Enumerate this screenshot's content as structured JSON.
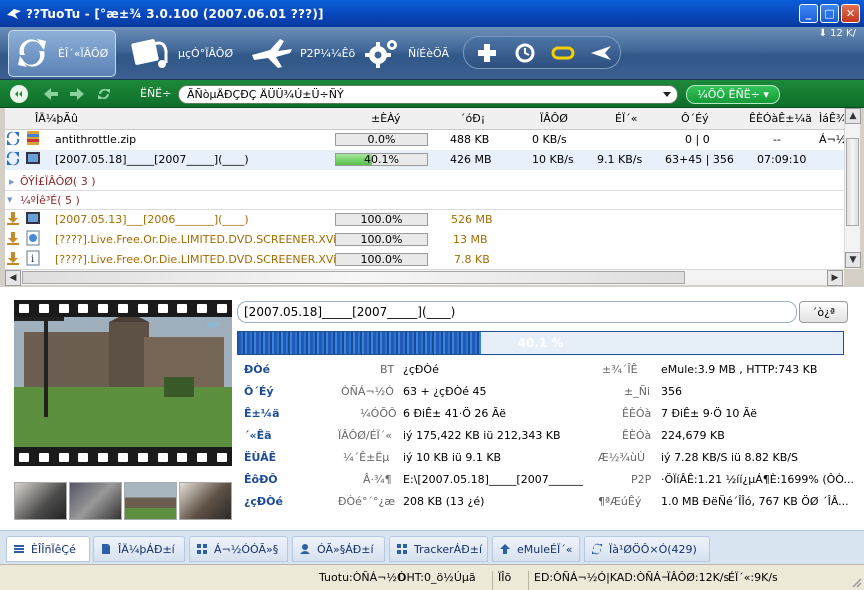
{
  "window": {
    "title": "??TuoTu - [°æ±¾ 3.0.100 (2007.06.01 ???)]",
    "buttons": [
      "_",
      "□",
      "✕"
    ]
  },
  "toolbar": {
    "items": [
      {
        "label": "ÈÎ´«ÏÂÔØ",
        "icon": "arrows-icon"
      },
      {
        "label": "µçÓ°ÏÂÔØ",
        "icon": "movie-icon"
      },
      {
        "label": "P2P¼¼Êõ",
        "icon": "plane-icon"
      },
      {
        "label": "ÑíÉèÖÃ",
        "icon": "gear-icon"
      }
    ],
    "small_icons": [
      "plus-icon",
      "clock-icon",
      "ring-icon",
      "share-icon"
    ],
    "speed": "12 K/"
  },
  "searchbar": {
    "label": "ËÑË÷",
    "input_value": "ÃÑòµÄÐÇÐÇ ÄÜÜ¾Ú±Ü÷ÑÝ",
    "go_label": "¼ÕÔ ËÑË÷"
  },
  "columns": [
    "ÎÄ¼þÃû",
    "±ÈÀý",
    "´óÐ¡",
    "ÏÂÔØ",
    "ÉÏ´«",
    "Ô´Éý",
    "ÊÈÓàÊ±¼ä",
    "ÌáÊ¾"
  ],
  "tasks": [
    {
      "name": "antithrottle.zip",
      "progress": 0.0,
      "progress_text": "0.0%",
      "size": "488 KB",
      "down": "0 KB/s",
      "up": "",
      "sources": "0 | 0",
      "remaining": "--",
      "extra": "Á¬½Ó"
    },
    {
      "name": "[2007.05.18]_____[2007_____](____)",
      "progress": 40.1,
      "progress_text": "40.1%",
      "size": "426 MB",
      "down": "10 KB/s",
      "up": "9.1 KB/s",
      "sources": "63+45 | 356",
      "remaining": "07:09:10",
      "extra": ""
    }
  ],
  "groups": [
    {
      "label": "ÔÝÍ£ÏÂÔØ( 3 )",
      "expanded": false
    },
    {
      "label": "¼ºÍê³É( 5 )",
      "expanded": true
    }
  ],
  "completed": [
    {
      "name": "[2007.05.13]___[2006_______](____)",
      "progress_text": "100.0%",
      "size": "526 MB"
    },
    {
      "name": "[????].Live.Free.Or.Die.LIMITED.DVD.SCREENER.XVi...",
      "progress_text": "100.0%",
      "size": "13 MB"
    },
    {
      "name": "[????].Live.Free.Or.Die.LIMITED.DVD.SCREENER.XVi...",
      "progress_text": "100.0%",
      "size": "7.8 KB"
    }
  ],
  "detail": {
    "title": "[2007.05.18]_____[2007_____](____)",
    "button": "´ò¿ª",
    "progress": 40.1,
    "progress_text": "40.1 %",
    "rows": [
      {
        "k": "Ð­Òé",
        "g": "BT",
        "v": "¿çÐ­Òé",
        "k2": "±¾´ÎÊ",
        "v2": "eMule:3.9 MB , HTTP:743 KB"
      },
      {
        "k": "Ô´Éý",
        "g": "ÒÑÁ¬½Ó",
        "v": "63 + ¿çÐ­Òé 45",
        "k2": "±_Ñi",
        "v2": "356"
      },
      {
        "k": "Ê±¼ä",
        "g": "¼ÓÕÔ",
        "v": "6 ÐiÊ± 41·Ö 26 Ãë",
        "k2": "ÊÈÓà",
        "v2": "7 ÐiÊ± 9·Ö 10 Ãë"
      },
      {
        "k": "´«Êä",
        "g": "ÏÂÔØ/ÉÏ´«",
        "v": "iý 175,422 KB iü 212,343 KB",
        "k2": "ÊÈÓà",
        "v2": "224,679 KB"
      },
      {
        "k": "ËÙÂÊ",
        "g": "¼´Ê±Ëµ",
        "v": "iý 10 KB iü 9.1 KB",
        "k2": "Æ½¾ùÙ",
        "v2": "iý 7.28 KB/S iü 8.82 KB/S"
      },
      {
        "k": "ÊôÐÔ",
        "g": "Â·¾¶",
        "v": "E:\\[2007.05.18]_____[2007_______...",
        "k2": "P2P",
        "v2": "·ÖÏíÂÊ:1.21  ½íí¿µÁ¶È:1699% (ÔÒ..."
      },
      {
        "k": "¿çÐ­Òé",
        "g": "Ð­Òé°´°¿æ",
        "v": "208 KB (13 ¿é)",
        "k2": "¶ªÆúÊý",
        "v2": "1.0 MB ÐëÑé´ÎÎó,  767 KB ÖØ ´ÎÂ..."
      }
    ]
  },
  "tabs": [
    {
      "label": "ÈÎÎñÏêÇé",
      "icon": "detail-icon",
      "active": true
    },
    {
      "label": "ÎÄ¼þÁÐ±í",
      "icon": "file-icon"
    },
    {
      "label": "Á¬½ÓÓÃ»§",
      "icon": "grid-icon"
    },
    {
      "label": "ÓÃ»§ÁÐ±í",
      "icon": "user-icon"
    },
    {
      "label": "TrackerÁÐ±í",
      "icon": "tracker-icon"
    },
    {
      "label": "eMuleÉÏ´«",
      "icon": "upload-icon"
    },
    {
      "label": "Ïà¹ØÖÔ×Ó(429)",
      "icon": "link-icon"
    }
  ],
  "status": {
    "app": "Tuotu:ÒÑÁ¬½Ó",
    "dht": "DHT:0_ö½Úµã",
    "lang": "ÏÎõ",
    "ed": "ED:ÒÑÁ¬½Ó|KAD:ÒÑÁ¬",
    "down": "ÏÂÔØ:12K/s",
    "up": "ÉÏ´«:9K/s"
  }
}
